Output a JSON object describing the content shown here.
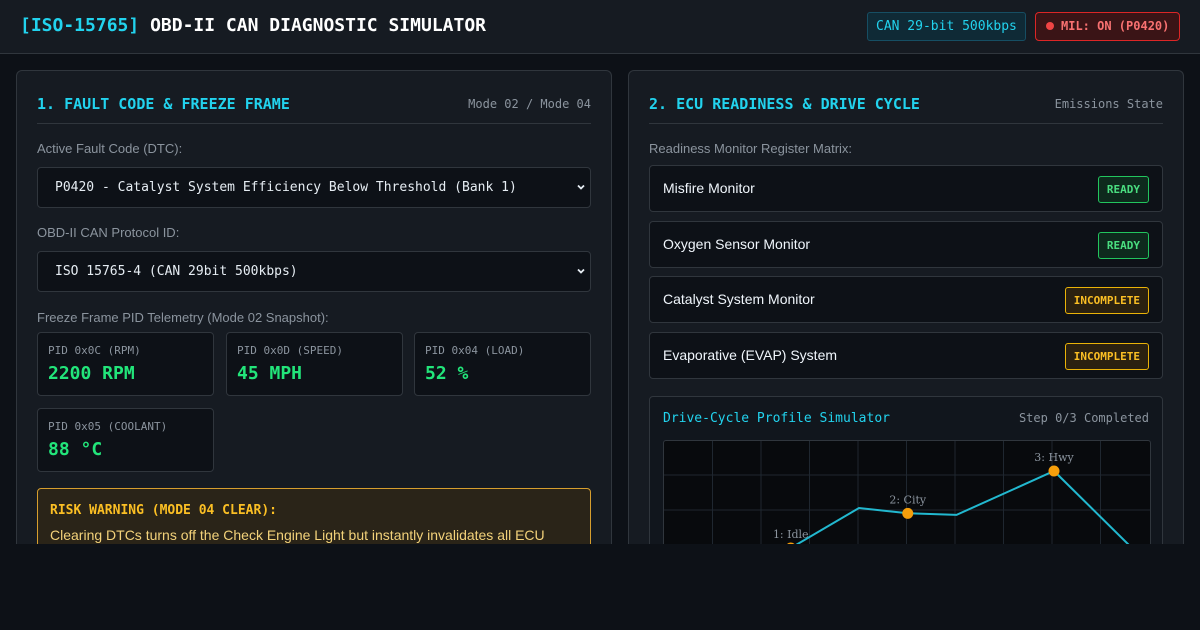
{
  "header": {
    "standard": "[ISO-15765]",
    "title": "OBD-II CAN DIAGNOSTIC SIMULATOR",
    "can_badge": "CAN 29-bit 500kbps",
    "mil_badge": "MIL: ON (P0420)"
  },
  "colors": {
    "accent": "#22d3ee",
    "ready": "#4ade80",
    "warning": "#fbbf24",
    "alert": "#ef4444"
  },
  "fault": {
    "title": "1. FAULT CODE & FREEZE FRAME",
    "meta": "Mode 02 / Mode 04",
    "dtc_label": "Active Fault Code (DTC):",
    "dtc_value": "P0420 - Catalyst System Efficiency Below Threshold (Bank 1)",
    "protocol_label": "OBD-II CAN Protocol ID:",
    "protocol_value": "ISO 15765-4 (CAN 29bit 500kbps)",
    "freeze_label": "Freeze Frame PID Telemetry (Mode 02 Snapshot):",
    "pids": [
      {
        "label": "PID 0x0C (RPM)",
        "value": "2200 RPM"
      },
      {
        "label": "PID 0x0D (SPEED)",
        "value": "45 MPH"
      },
      {
        "label": "PID 0x04 (LOAD)",
        "value": "52 %"
      },
      {
        "label": "PID 0x05 (COOLANT)",
        "value": "88 °C"
      }
    ],
    "risk_title": "RISK WARNING (MODE 04 CLEAR):",
    "risk_text": "Clearing DTCs turns off the Check Engine Light but instantly invalidates all ECU"
  },
  "readiness": {
    "title": "2. ECU READINESS & DRIVE CYCLE",
    "meta": "Emissions State",
    "matrix_label": "Readiness Monitor Register Matrix:",
    "monitors": [
      {
        "name": "Misfire Monitor",
        "status": "READY",
        "state": "ready"
      },
      {
        "name": "Oxygen Sensor Monitor",
        "status": "READY",
        "state": "ready"
      },
      {
        "name": "Catalyst System Monitor",
        "status": "INCOMPLETE",
        "state": "incomplete"
      },
      {
        "name": "Evaporative (EVAP) System",
        "status": "INCOMPLETE",
        "state": "incomplete"
      }
    ],
    "sim_title": "Drive-Cycle Profile Simulator",
    "sim_step": "Step 0/3 Completed",
    "points": [
      {
        "x": 1.3,
        "y": 0,
        "label": "1: Idle"
      },
      {
        "x": 2.5,
        "y": 0.45,
        "label": "2: City"
      },
      {
        "x": 4.0,
        "y": 1.0,
        "label": "3: Hwy"
      }
    ],
    "line_color": "#22b8cf",
    "point_color": "#f59e0b"
  }
}
